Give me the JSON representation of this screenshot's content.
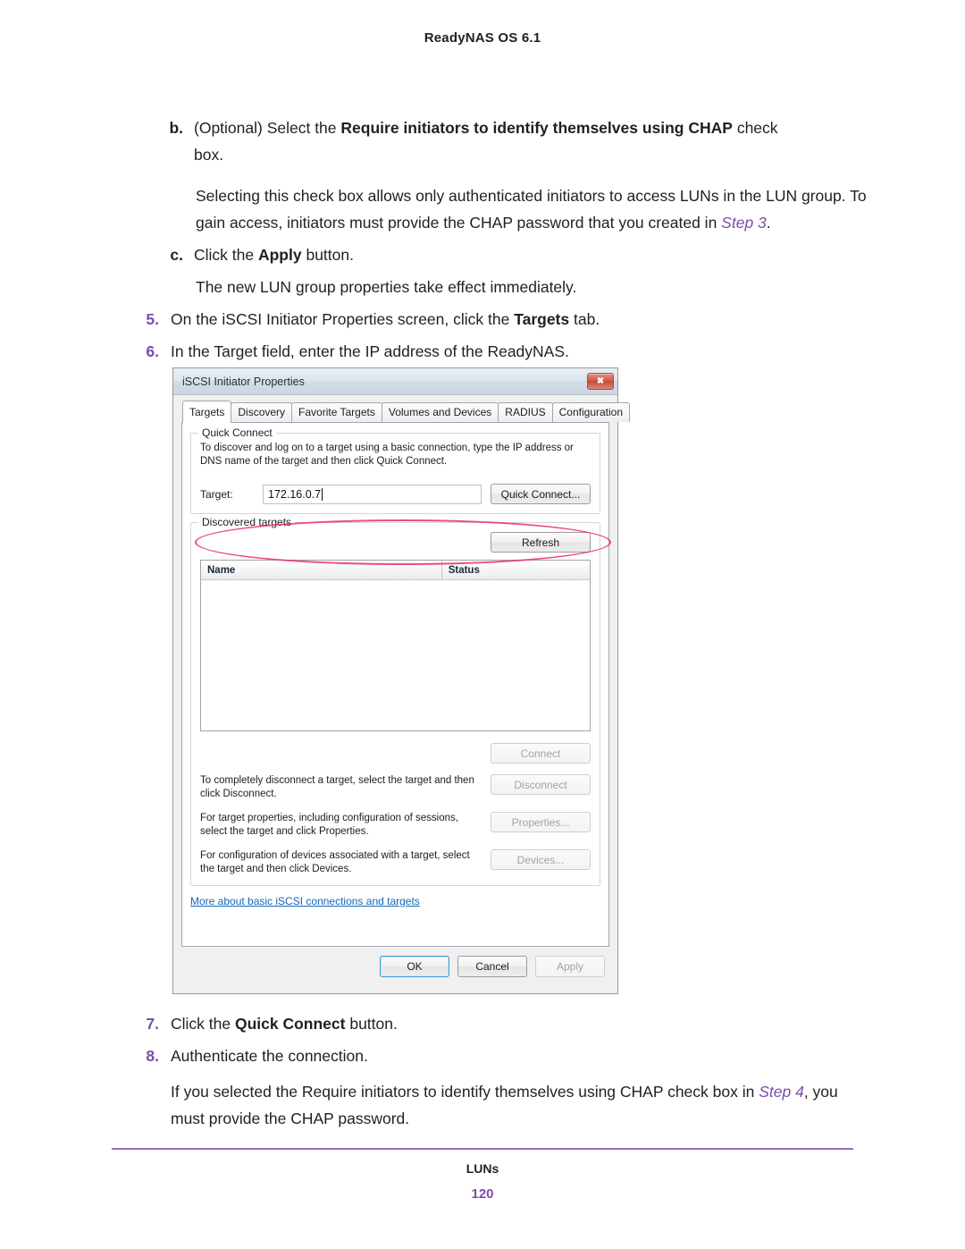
{
  "page": {
    "header": "ReadyNAS OS 6.1",
    "footer_section": "LUNs",
    "footer_page_number": "120",
    "accent_purple": "#7b4ea8",
    "rule_color": "#8f6fbd"
  },
  "steps": {
    "b": {
      "marker": "b.",
      "text_before": "(Optional) Select the ",
      "bold": "Require initiators to identify themselves using CHAP",
      "text_after": " check box."
    },
    "b_para": {
      "text_before": "Selecting this check box allows only authenticated initiators to access LUNs in the LUN group. To gain access, initiators must provide the CHAP password that you created in ",
      "xref": "Step 3",
      "text_after": "."
    },
    "c": {
      "marker": "c.",
      "text_before": "Click the ",
      "bold": "Apply",
      "text_after": " button."
    },
    "c_para": {
      "text": "The new LUN group properties take effect immediately."
    },
    "five": {
      "marker": "5.",
      "text_before": "On the iSCSI Initiator Properties screen, click the ",
      "bold": "Targets",
      "text_after": " tab."
    },
    "six": {
      "marker": "6.",
      "text": "In the Target field, enter the IP address of the ReadyNAS."
    },
    "seven": {
      "marker": "7.",
      "text_before": "Click the ",
      "bold": "Quick Connect",
      "text_after": " button."
    },
    "eight": {
      "marker": "8.",
      "text": "Authenticate the connection."
    },
    "eight_para": {
      "text_before": "If you selected the Require initiators to identify themselves using CHAP check box in ",
      "xref": "Step 4",
      "text_after": ", you must provide the CHAP password."
    }
  },
  "dialog": {
    "title": "iSCSI Initiator Properties",
    "close_icon": "close-icon",
    "close_glyph": "✖",
    "tabs": [
      {
        "label": "Targets",
        "active": true
      },
      {
        "label": "Discovery",
        "active": false
      },
      {
        "label": "Favorite Targets",
        "active": false
      },
      {
        "label": "Volumes and Devices",
        "active": false
      },
      {
        "label": "RADIUS",
        "active": false
      },
      {
        "label": "Configuration",
        "active": false
      }
    ],
    "quick_connect": {
      "group_title": "Quick Connect",
      "description": "To discover and log on to a target using a basic connection, type the IP address or DNS name of the target and then click Quick Connect.",
      "target_label": "Target:",
      "target_value": "172.16.0.7",
      "target_placeholder": "",
      "button_label": "Quick Connect..."
    },
    "discovered_targets": {
      "group_title": "Discovered targets",
      "refresh_label": "Refresh",
      "columns": [
        "Name",
        "Status"
      ],
      "rows": []
    },
    "actions": [
      {
        "text": "",
        "button": "Connect",
        "disabled": true
      },
      {
        "text": "To completely disconnect a target, select the target and then click Disconnect.",
        "button": "Disconnect",
        "disabled": true
      },
      {
        "text": "For target properties, including configuration of sessions, select the target and click Properties.",
        "button": "Properties...",
        "disabled": true
      },
      {
        "text": "For configuration of devices associated with a target, select the target and then click Devices.",
        "button": "Devices...",
        "disabled": true
      }
    ],
    "more_link": "More about basic iSCSI connections and targets",
    "footer_buttons": [
      {
        "label": "OK",
        "default": true,
        "disabled": false
      },
      {
        "label": "Cancel",
        "default": false,
        "disabled": false
      },
      {
        "label": "Apply",
        "default": false,
        "disabled": true
      }
    ],
    "annotation": {
      "shape": "ellipse",
      "color": "#ec2d66",
      "targets": "target-row"
    }
  }
}
